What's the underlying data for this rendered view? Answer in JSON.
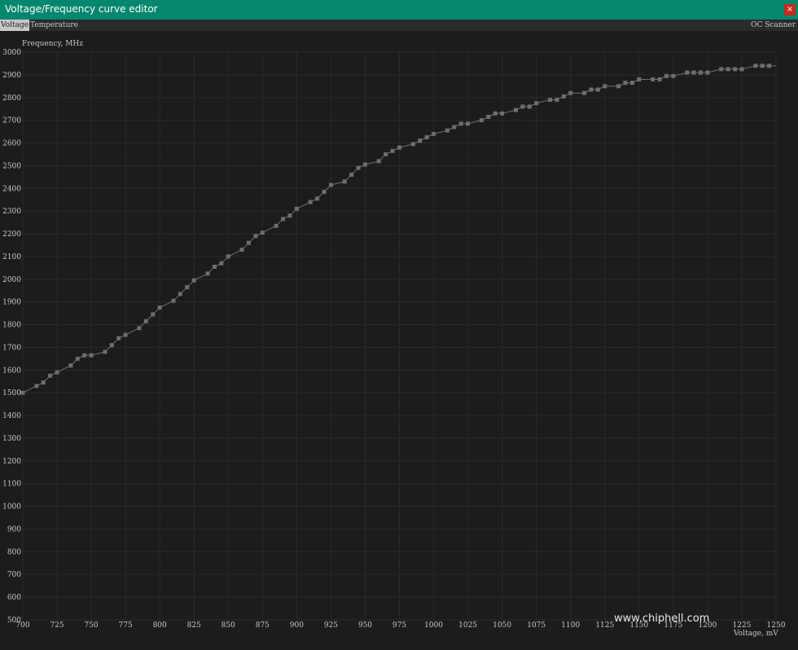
{
  "window": {
    "title": "Voltage/Frequency curve editor",
    "close_label": "×"
  },
  "tabs": {
    "voltage": "Voltage",
    "temperature": "Temperature",
    "oc_scanner": "OC Scanner"
  },
  "watermark": "www.chiphell.com",
  "colors": {
    "titlebar": "#04876e",
    "background": "#1c1c1e",
    "curve": "#6e6e6e",
    "close": "#c42b1c"
  },
  "chart_data": {
    "type": "line",
    "ylabel": "Frequency, MHz",
    "xlabel": "Voltage, mV",
    "xlim": [
      700,
      1250
    ],
    "ylim": [
      500,
      3000
    ],
    "grid": true,
    "x_ticks": [
      "700",
      "725",
      "750",
      "775",
      "800",
      "825",
      "850",
      "875",
      "900",
      "925",
      "950",
      "975",
      "1000",
      "1025",
      "1050",
      "1075",
      "1100",
      "1125",
      "1150",
      "1175",
      "1200",
      "1225",
      "1250"
    ],
    "y_ticks": [
      "500",
      "600",
      "700",
      "800",
      "900",
      "1000",
      "1100",
      "1200",
      "1300",
      "1400",
      "1500",
      "1600",
      "1700",
      "1800",
      "1900",
      "2000",
      "2100",
      "2200",
      "2300",
      "2400",
      "2500",
      "2600",
      "2700",
      "2800",
      "2900",
      "3000"
    ],
    "series": [
      {
        "x": [
          700,
          710,
          715,
          720,
          725,
          735,
          740,
          745,
          750,
          760,
          765,
          770,
          775,
          785,
          790,
          795,
          800,
          810,
          815,
          820,
          825,
          835,
          840,
          845,
          850,
          860,
          865,
          870,
          875,
          885,
          890,
          895,
          900,
          910,
          915,
          920,
          925,
          935,
          940,
          945,
          950,
          960,
          965,
          970,
          975,
          985,
          990,
          995,
          1000,
          1010,
          1015,
          1020,
          1025,
          1035,
          1040,
          1045,
          1050,
          1060,
          1065,
          1070,
          1075,
          1085,
          1090,
          1095,
          1100,
          1110,
          1115,
          1120,
          1125,
          1135,
          1140,
          1145,
          1150,
          1160,
          1165,
          1170,
          1175,
          1185,
          1190,
          1195,
          1200,
          1210,
          1215,
          1220,
          1225,
          1235,
          1240,
          1245
        ],
        "y": [
          1500,
          1530,
          1545,
          1575,
          1590,
          1620,
          1650,
          1665,
          1665,
          1680,
          1710,
          1740,
          1755,
          1785,
          1815,
          1845,
          1875,
          1905,
          1935,
          1965,
          1995,
          2025,
          2055,
          2070,
          2100,
          2130,
          2160,
          2190,
          2205,
          2235,
          2265,
          2280,
          2310,
          2340,
          2355,
          2385,
          2415,
          2430,
          2460,
          2490,
          2505,
          2520,
          2550,
          2565,
          2580,
          2595,
          2610,
          2625,
          2640,
          2655,
          2670,
          2685,
          2685,
          2700,
          2715,
          2730,
          2730,
          2745,
          2760,
          2760,
          2775,
          2790,
          2790,
          2805,
          2820,
          2820,
          2835,
          2835,
          2850,
          2850,
          2865,
          2865,
          2880,
          2880,
          2880,
          2895,
          2895,
          2910,
          2910,
          2910,
          2910,
          2925,
          2925,
          2925,
          2925,
          2940,
          2940,
          2940
        ]
      }
    ]
  }
}
